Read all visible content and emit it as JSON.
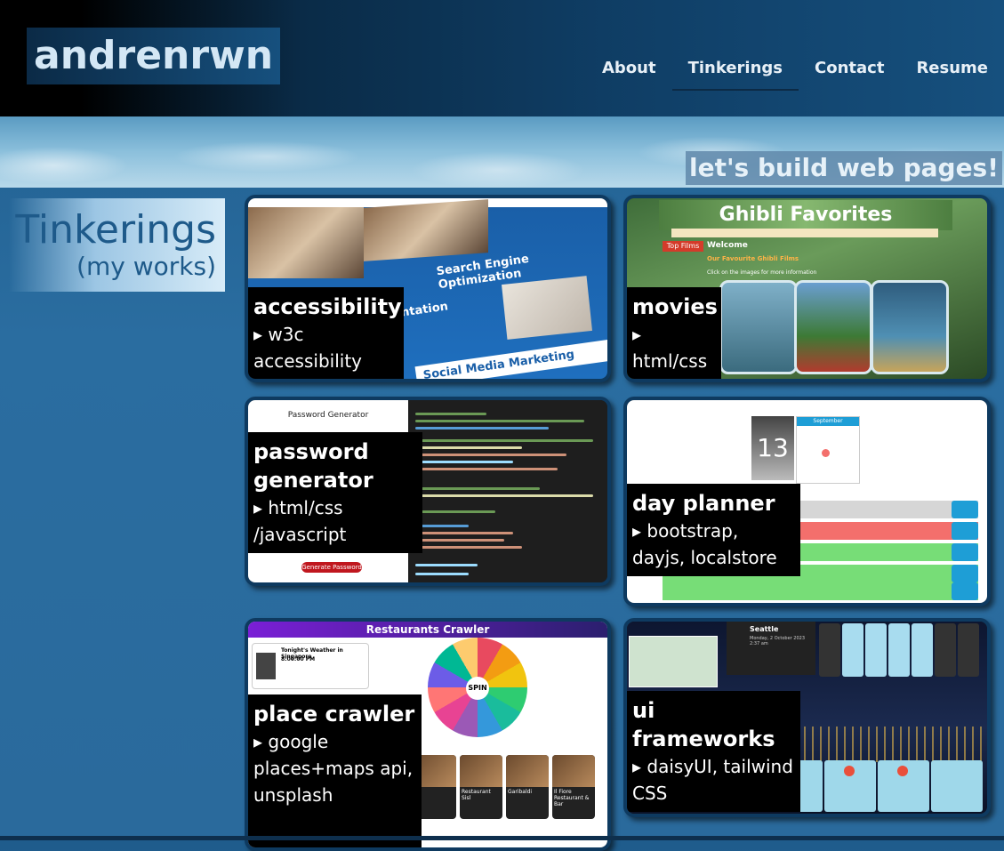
{
  "header": {
    "logo": "andrenrwn",
    "nav": [
      {
        "label": "About",
        "active": false
      },
      {
        "label": "Tinkerings",
        "active": true
      },
      {
        "label": "Contact",
        "active": false
      },
      {
        "label": "Resume",
        "active": false
      }
    ]
  },
  "banner": {
    "tagline": "let's build web pages!"
  },
  "section": {
    "title": "Tinkerings",
    "subtitle": "(my works)"
  },
  "projects": [
    {
      "title": "accessibility",
      "tech": "▸ w3c accessibility"
    },
    {
      "title": "movies",
      "tech": "▸ html/css"
    },
    {
      "title": "password generator",
      "tech": "▸ html/css /javascript"
    },
    {
      "title": "day planner",
      "tech": "▸ bootstrap, dayjs, localstore"
    },
    {
      "title": "place crawler",
      "tech": "▸ google places+maps api, unsplash"
    },
    {
      "title": "ui frameworks",
      "tech": "▸ daisyUI, tailwind CSS"
    }
  ],
  "thumbs": {
    "accessibility": {
      "band1": "Search Engine Optimization",
      "band2": "Social Media Marketing",
      "side": "ntation"
    },
    "movies": {
      "header": "Ghibli Favorites",
      "menu": "Top Films",
      "welcome": "Welcome",
      "fav": "Our Favourite Ghibli Films",
      "hint": "Click on the images for more information"
    },
    "password": {
      "title": "Password Generator",
      "button": "Generate Password"
    },
    "planner": {
      "day": "13",
      "month": "September"
    },
    "crawler": {
      "header": "Restaurants Crawler",
      "weather": "Tonight's Weather in Singapore",
      "time": "8:00:00 PM",
      "spin": "SPIN",
      "r1": "Restaurant Sisl",
      "r2": "Garibaldi",
      "r3": "Il Fiore Restaurant & Bar",
      "r4": "Whitegrass Restaurant"
    },
    "ui": {
      "city": "Seattle",
      "date": "Monday, 2 October 2023 2:37 am"
    }
  },
  "colors": {
    "card_border": "#0e3a60",
    "accent_red": "#c0171e",
    "planner_red": "#f36f6c",
    "planner_green": "#77dd77"
  }
}
